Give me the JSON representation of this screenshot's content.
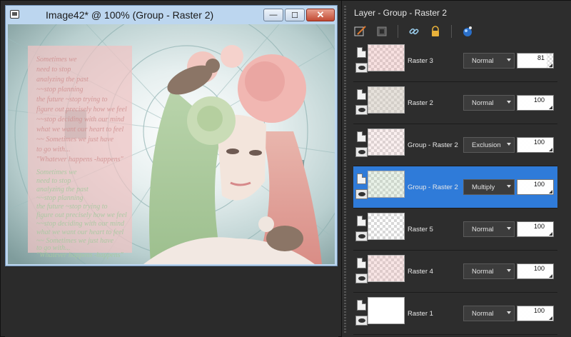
{
  "image_window": {
    "title": "Image42* @ 100% (Group - Raster 2)",
    "buttons": {
      "minimize": "—",
      "maximize": "☐",
      "close": "✕"
    },
    "poem_lines": [
      "Sometimes we",
      "need to stop",
      "analyzing the past",
      "~~stop planning",
      "the future ~stop trying to",
      "figure out precisely how we feel",
      "~~stop deciding with our mind",
      "what we want our heart to feel",
      "~~ Sometimes we just have",
      "to go with...",
      "\"Whatever happens -happens\""
    ]
  },
  "layers_panel": {
    "title": "Layer - Group - Raster 2",
    "layers": [
      {
        "name": "Raster 3",
        "blend": "Normal",
        "opacity": "81",
        "opacity_fraction": 0.81,
        "selected": false,
        "thumb": "checker",
        "tint": "rgba(235,170,170,0.35)"
      },
      {
        "name": "Raster 2",
        "blend": "Normal",
        "opacity": "100",
        "opacity_fraction": 1.0,
        "selected": false,
        "thumb": "checker",
        "tint": "rgba(210,200,190,0.55)"
      },
      {
        "name": "Group - Raster 2",
        "blend": "Exclusion",
        "opacity": "100",
        "opacity_fraction": 1.0,
        "selected": false,
        "thumb": "checker",
        "tint": "rgba(235,190,190,0.25)"
      },
      {
        "name": "Group - Raster 2",
        "blend": "Multiply",
        "opacity": "100",
        "opacity_fraction": 1.0,
        "selected": true,
        "thumb": "checker",
        "tint": "rgba(190,215,185,0.35)"
      },
      {
        "name": "Raster 5",
        "blend": "Normal",
        "opacity": "100",
        "opacity_fraction": 1.0,
        "selected": false,
        "thumb": "checker",
        "tint": "rgba(0,0,0,0)"
      },
      {
        "name": "Raster 4",
        "blend": "Normal",
        "opacity": "100",
        "opacity_fraction": 1.0,
        "selected": false,
        "thumb": "checker",
        "tint": "rgba(235,180,180,0.35)"
      },
      {
        "name": "Raster 1",
        "blend": "Normal",
        "opacity": "100",
        "opacity_fraction": 1.0,
        "selected": false,
        "thumb": "white",
        "tint": "rgba(0,0,0,0)"
      }
    ]
  },
  "colors": {
    "selected_row": "#2f7bd9",
    "panel_bg": "#2d2d2d",
    "window_frame": "#bcd6ef"
  }
}
